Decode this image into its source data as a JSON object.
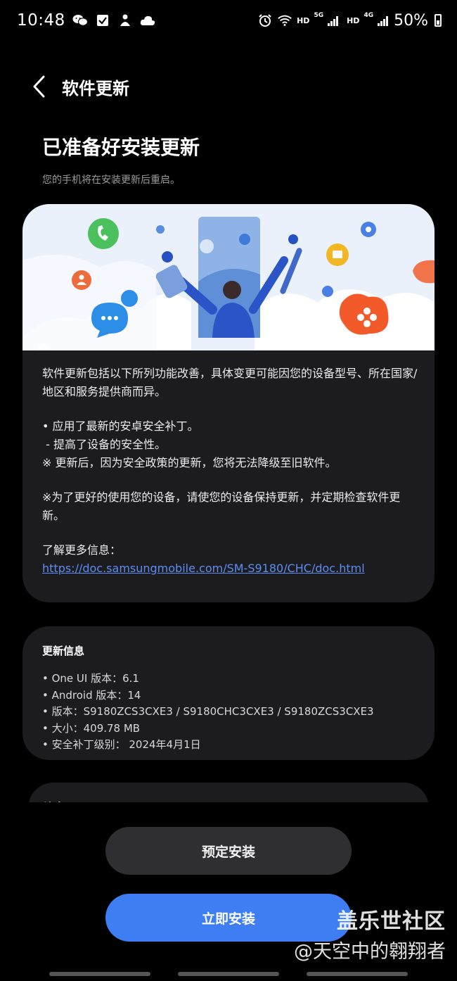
{
  "status_bar": {
    "time": "10:48",
    "hd1": "HD",
    "net1": "5G",
    "hd2": "HD",
    "net2": "4G",
    "battery": "50%"
  },
  "header": {
    "title": "软件更新"
  },
  "ready": {
    "title": "已准备好安装更新",
    "subtitle": "您的手机将在安装更新后重启。"
  },
  "description": {
    "intro": "软件更新包括以下所列功能改善，具体变更可能因您的设备型号、所在国家/地区和服务提供商而异。",
    "bullet1": "• 应用了最新的安卓安全补丁。",
    "bullet1_sub": " - 提高了设备的安全性。",
    "note1": "※ 更新后，因为安全政策的更新，您将无法降级至旧软件。",
    "note2": "※为了更好的使用您的设备，请使您的设备保持更新，并定期检查软件更新。",
    "more_label": "了解更多信息：",
    "more_link": "https://doc.samsungmobile.com/SM-S9180/CHC/doc.html"
  },
  "update_info": {
    "title": "更新信息",
    "one_ui": "• One UI 版本：6.1",
    "android": "• Android 版本：14",
    "version": "• 版本：S9180ZCS3CXE3 / S9180CHC3CXE3 / S9180ZCS3CXE3",
    "size": "• 大小：409.78 MB",
    "patch": "• 安全补丁级别： 2024年4月1日"
  },
  "notice": {
    "label": "注意"
  },
  "buttons": {
    "schedule": "预定安装",
    "install": "立即安装"
  },
  "watermark": {
    "brand": "盖乐世社区",
    "user": "@天空中的翱翔者"
  },
  "colors": {
    "accent": "#3f7ef2",
    "card": "#1c1c1e",
    "link": "#5a8ef5"
  }
}
